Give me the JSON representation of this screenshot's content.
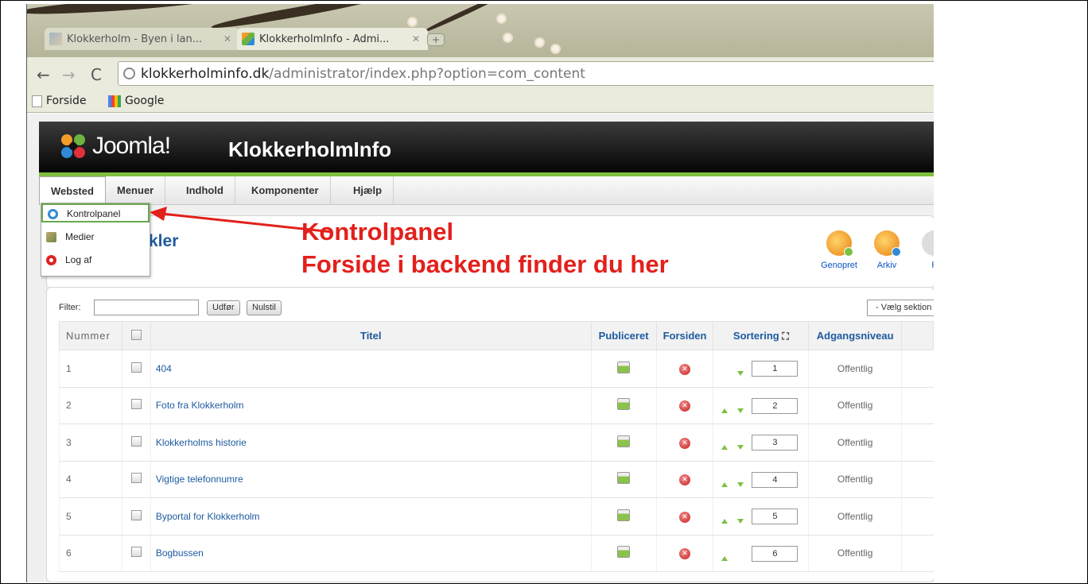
{
  "browser": {
    "tabs": [
      {
        "title": "Klokkerholm - Byen i lan...",
        "active": false
      },
      {
        "title": "KlokkerholmInfo - Admi...",
        "active": true
      }
    ],
    "url_host": "klokkerholminfo.dk",
    "url_path": "/administrator/index.php?option=com_content",
    "bookmarks": [
      "Forside",
      "Google"
    ]
  },
  "joomla": {
    "logo_text": "Joomla!",
    "site_name": "KlokkerholmInfo",
    "menu": [
      "Websted",
      "Menuer",
      "Indhold",
      "Komponenter",
      "Hjælp"
    ],
    "dropdown": [
      "Kontrolpanel",
      "Medier",
      "Log af"
    ],
    "page_title": "kler",
    "toolbar": [
      "Genopret",
      "Arkiv",
      "P"
    ]
  },
  "annotation": {
    "line1": "Kontrolpanel",
    "line2": "Forside i backend finder du her"
  },
  "filter": {
    "label": "Filter:",
    "go_label": "Udfør",
    "reset_label": "Nulstil",
    "section_select": "- Vælg sektion"
  },
  "table": {
    "headers": {
      "number": "Nummer",
      "title": "Titel",
      "published": "Publiceret",
      "frontpage": "Forsiden",
      "ordering": "Sortering",
      "access": "Adgangsniveau"
    },
    "rows": [
      {
        "num": "1",
        "title": "404",
        "order": "1",
        "access": "Offentlig"
      },
      {
        "num": "2",
        "title": "Foto fra Klokkerholm",
        "order": "2",
        "access": "Offentlig"
      },
      {
        "num": "3",
        "title": "Klokkerholms historie",
        "order": "3",
        "access": "Offentlig"
      },
      {
        "num": "4",
        "title": "Vigtige telefonnumre",
        "order": "4",
        "access": "Offentlig"
      },
      {
        "num": "5",
        "title": "Byportal for Klokkerholm",
        "order": "5",
        "access": "Offentlig"
      },
      {
        "num": "6",
        "title": "Bogbussen",
        "order": "6",
        "access": "Offentlig"
      }
    ]
  },
  "colors": {
    "accent_blue": "#1d5a9f",
    "joomla_green": "#7fbf3d",
    "annotation_red": "#e3201b",
    "access_green": "#3f9b1f"
  }
}
